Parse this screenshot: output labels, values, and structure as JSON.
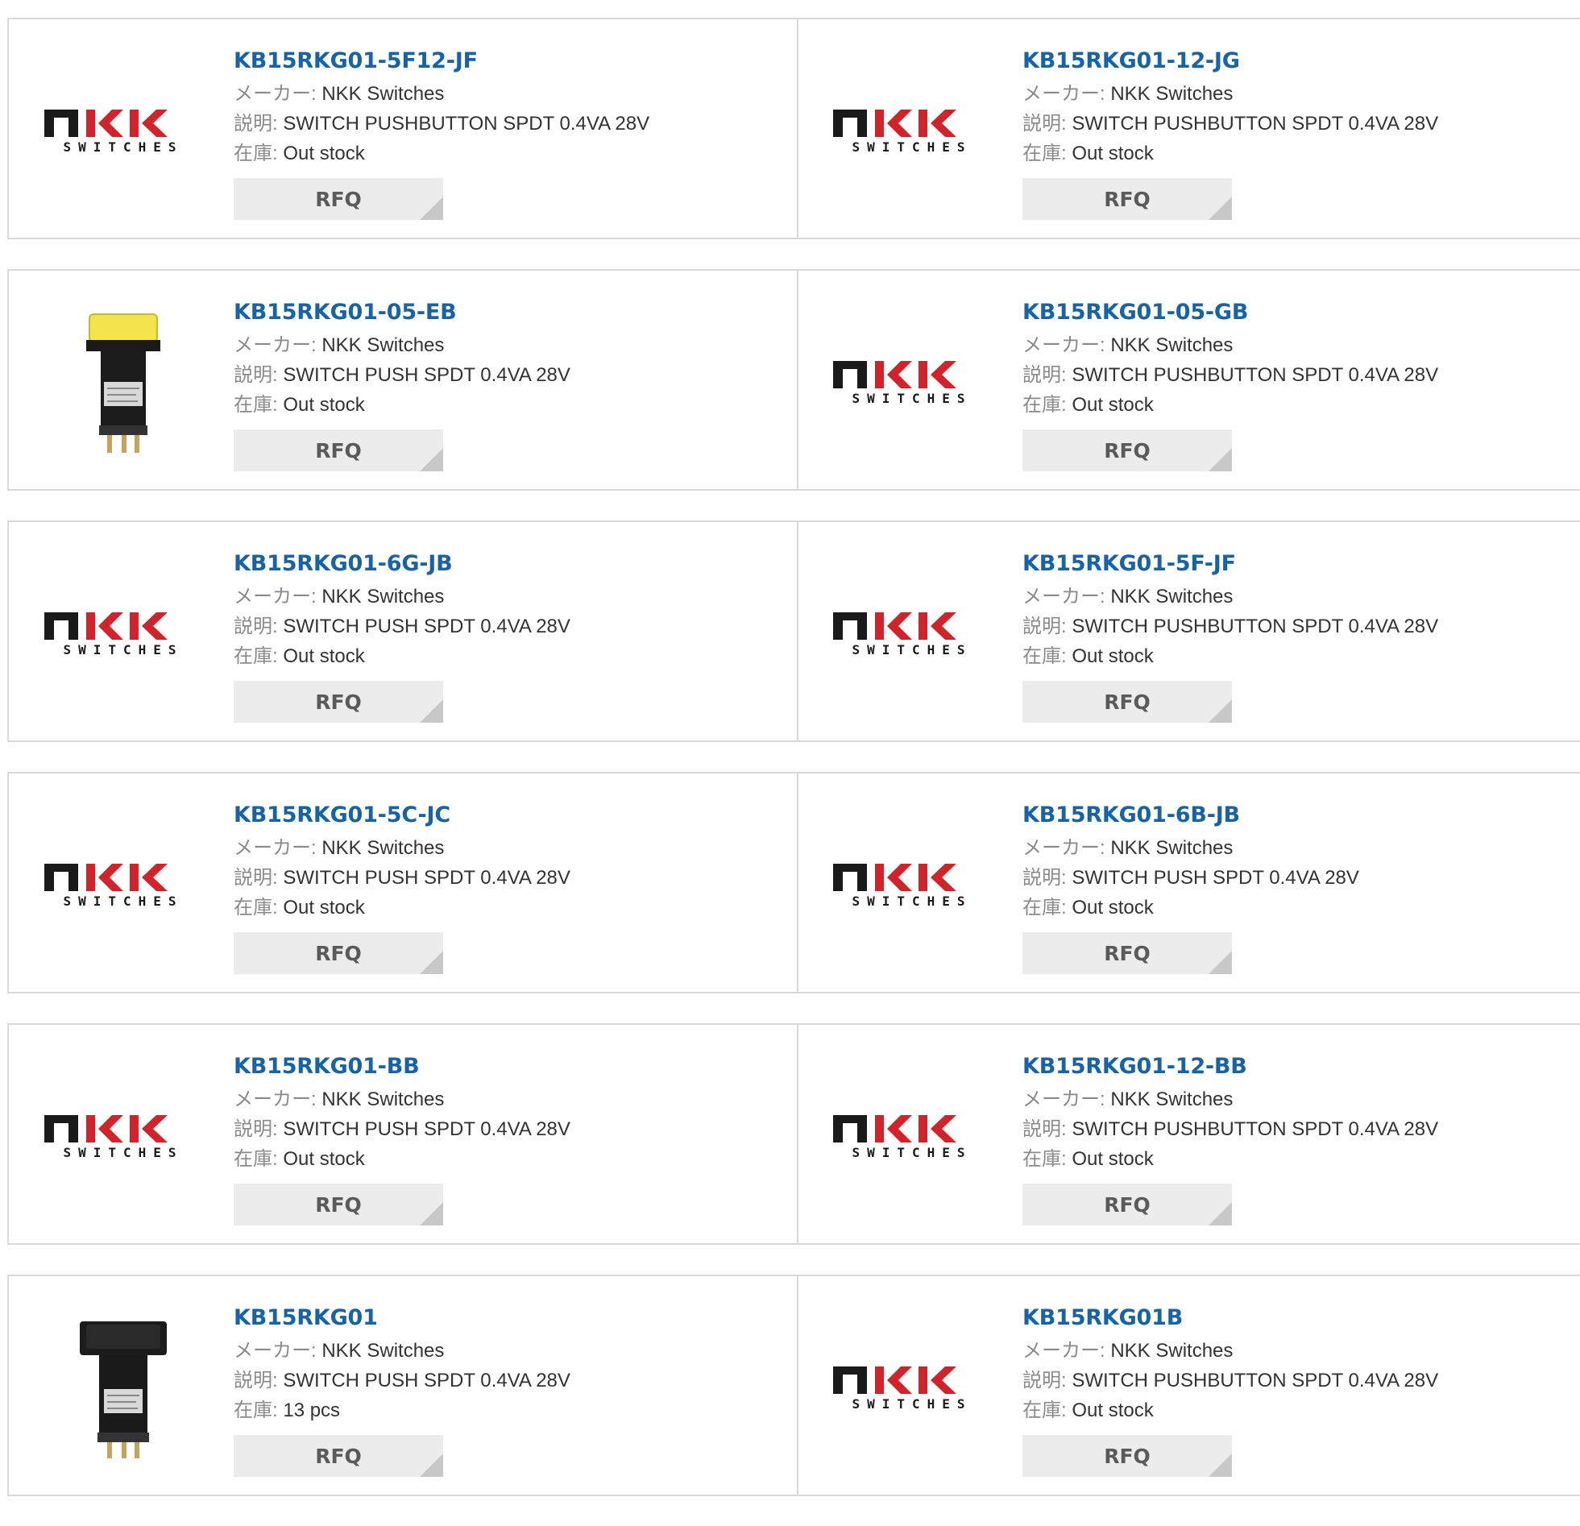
{
  "labels": {
    "maker": "メーカー:",
    "desc": "説明:",
    "stock": "在庫:",
    "rfq": "RFQ"
  },
  "logo_text": {
    "mark": "NKK",
    "sub": "SWITCHES"
  },
  "products": [
    {
      "name": "KB15RKG01-5F12-JF",
      "maker": "NKK Switches",
      "desc": "SWITCH PUSHBUTTON SPDT 0.4VA 28V",
      "stock": "Out stock",
      "image": "nkk-logo"
    },
    {
      "name": "KB15RKG01-12-JG",
      "maker": "NKK Switches",
      "desc": "SWITCH PUSHBUTTON SPDT 0.4VA 28V",
      "stock": "Out stock",
      "image": "nkk-logo"
    },
    {
      "name": "KB15RKG01-05-EB",
      "maker": "NKK Switches",
      "desc": "SWITCH PUSH SPDT 0.4VA 28V",
      "stock": "Out stock",
      "image": "yellow-switch-photo"
    },
    {
      "name": "KB15RKG01-05-GB",
      "maker": "NKK Switches",
      "desc": "SWITCH PUSHBUTTON SPDT 0.4VA 28V",
      "stock": "Out stock",
      "image": "nkk-logo"
    },
    {
      "name": "KB15RKG01-6G-JB",
      "maker": "NKK Switches",
      "desc": "SWITCH PUSH SPDT 0.4VA 28V",
      "stock": "Out stock",
      "image": "nkk-logo"
    },
    {
      "name": "KB15RKG01-5F-JF",
      "maker": "NKK Switches",
      "desc": "SWITCH PUSHBUTTON SPDT 0.4VA 28V",
      "stock": "Out stock",
      "image": "nkk-logo"
    },
    {
      "name": "KB15RKG01-5C-JC",
      "maker": "NKK Switches",
      "desc": "SWITCH PUSH SPDT 0.4VA 28V",
      "stock": "Out stock",
      "image": "nkk-logo"
    },
    {
      "name": "KB15RKG01-6B-JB",
      "maker": "NKK Switches",
      "desc": "SWITCH PUSH SPDT 0.4VA 28V",
      "stock": "Out stock",
      "image": "nkk-logo"
    },
    {
      "name": "KB15RKG01-BB",
      "maker": "NKK Switches",
      "desc": "SWITCH PUSH SPDT 0.4VA 28V",
      "stock": "Out stock",
      "image": "nkk-logo"
    },
    {
      "name": "KB15RKG01-12-BB",
      "maker": "NKK Switches",
      "desc": "SWITCH PUSHBUTTON SPDT 0.4VA 28V",
      "stock": "Out stock",
      "image": "nkk-logo"
    },
    {
      "name": "KB15RKG01",
      "maker": "NKK Switches",
      "desc": "SWITCH PUSH SPDT 0.4VA 28V",
      "stock": "13 pcs",
      "image": "black-switch-photo"
    },
    {
      "name": "KB15RKG01B",
      "maker": "NKK Switches",
      "desc": "SWITCH PUSHBUTTON SPDT 0.4VA 28V",
      "stock": "Out stock",
      "image": "nkk-logo"
    }
  ],
  "colors": {
    "link": "#1763a8",
    "border": "#d9d9d9",
    "button_bg": "#ececec",
    "logo_red": "#d2232a",
    "logo_black": "#1a1a1a",
    "switch_yellow": "#f2e44a"
  }
}
